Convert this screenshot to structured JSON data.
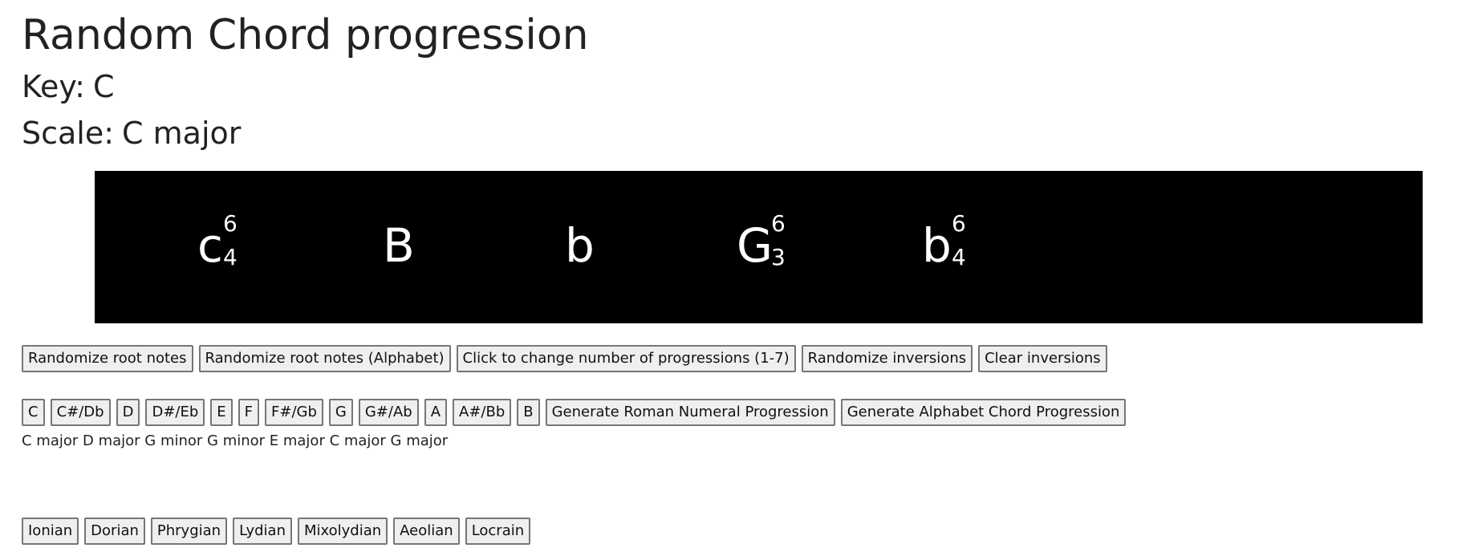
{
  "page": {
    "title": "Random Chord progression",
    "key_label": "Key:",
    "key_value": "C",
    "scale_label": "Scale:",
    "scale_value": "C major"
  },
  "display": {
    "chords": [
      {
        "root": "c",
        "sup": "6",
        "sub": "4"
      },
      {
        "root": "B",
        "sup": "",
        "sub": ""
      },
      {
        "root": "b",
        "sup": "",
        "sub": ""
      },
      {
        "root": "G",
        "sup": "6",
        "sub": "3"
      },
      {
        "root": "b",
        "sup": "6",
        "sub": "4"
      }
    ]
  },
  "controls": {
    "randomize_root": "Randomize root notes",
    "randomize_root_alphabet": "Randomize root notes (Alphabet)",
    "change_count": "Click to change number of progressions (1-7)",
    "randomize_inversions": "Randomize inversions",
    "clear_inversions": "Clear inversions"
  },
  "keys": {
    "notes": [
      "C",
      "C#/Db",
      "D",
      "D#/Eb",
      "E",
      "F",
      "F#/Gb",
      "G",
      "G#/Ab",
      "A",
      "A#/Bb",
      "B"
    ],
    "generate_roman": "Generate Roman Numeral Progression",
    "generate_alphabet": "Generate Alphabet Chord Progression"
  },
  "progression_text": "C major D major G minor G minor E major C major G major",
  "modes": [
    "Ionian",
    "Dorian",
    "Phrygian",
    "Lydian",
    "Mixolydian",
    "Aeolian",
    "Locrain"
  ]
}
